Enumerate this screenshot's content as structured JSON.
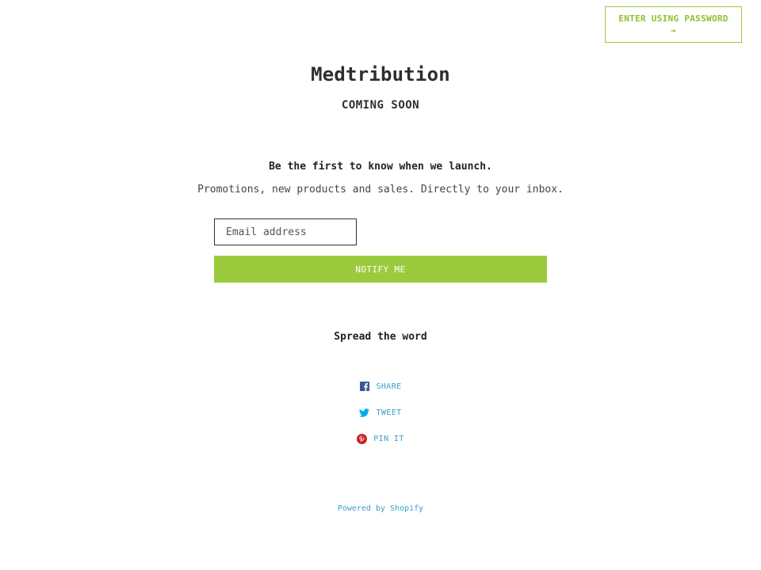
{
  "header": {
    "password_label": "ENTER USING PASSWORD",
    "password_arrow": "→"
  },
  "hero": {
    "title": "Medtribution",
    "subtitle": "COMING SOON"
  },
  "newsletter": {
    "heading": "Be the first to know when we launch.",
    "description": "Promotions, new products and sales. Directly to your inbox.",
    "email_placeholder": "Email address",
    "email_value": "",
    "submit_label": "NOTIFY ME"
  },
  "social": {
    "heading": "Spread the word",
    "links": [
      {
        "label": "SHARE",
        "icon": "facebook-icon",
        "color": "#3b5998"
      },
      {
        "label": "TWEET",
        "icon": "twitter-icon",
        "color": "#00aced"
      },
      {
        "label": "PIN IT",
        "icon": "pinterest-icon",
        "color": "#cb2027"
      }
    ]
  },
  "footer": {
    "powered_by": "Powered by Shopify"
  },
  "colors": {
    "accent": "#9bcb3d",
    "link": "#3b9fc2",
    "text": "#222222"
  }
}
